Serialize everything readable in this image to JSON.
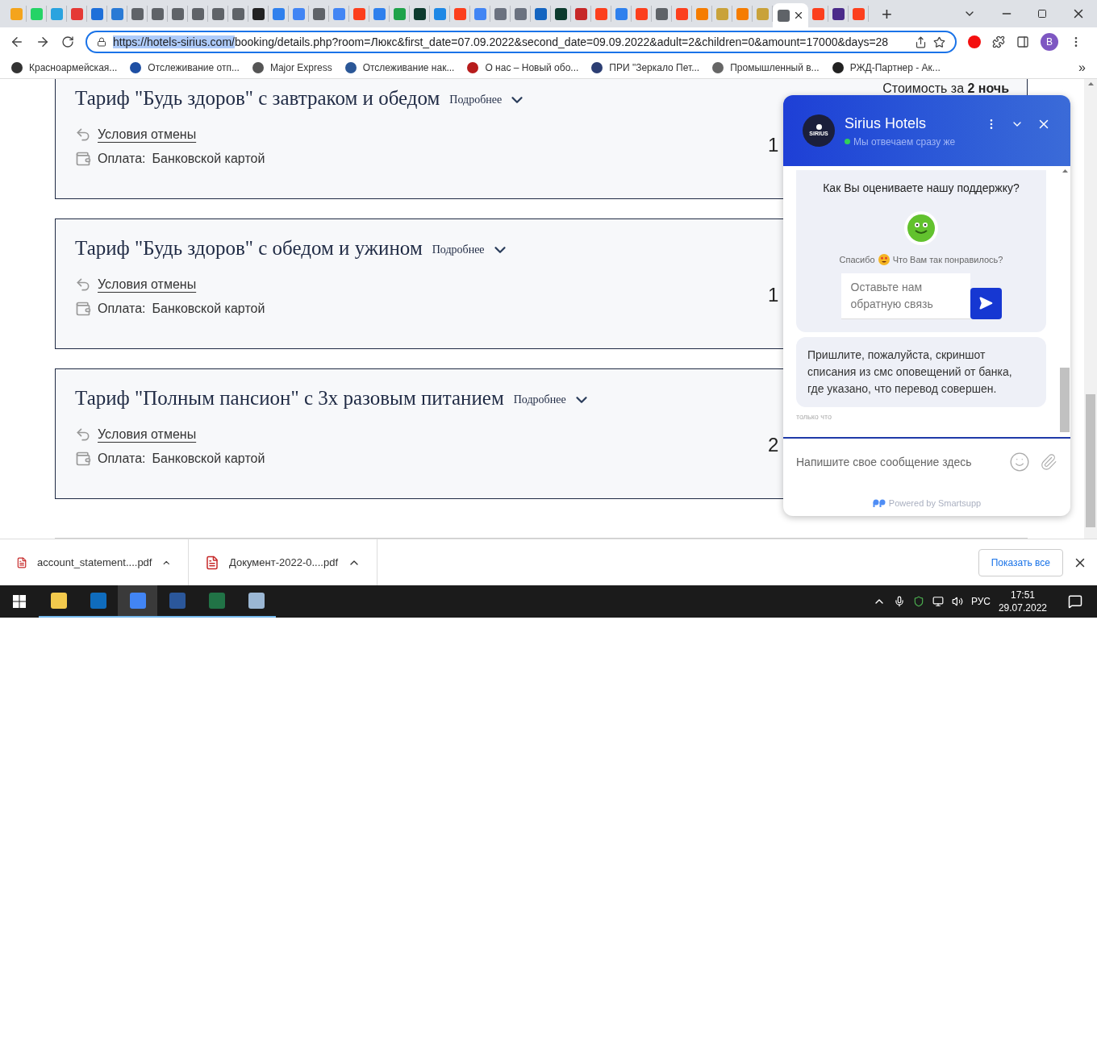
{
  "browser": {
    "tabs": [
      {
        "color": "#f4a41c",
        "selected": false
      },
      {
        "color": "#25d366",
        "selected": false
      },
      {
        "color": "#2aa3df",
        "selected": false
      },
      {
        "color": "#e53935",
        "selected": false
      },
      {
        "color": "#1e6fd9",
        "selected": false
      },
      {
        "color": "#2a7ad5",
        "selected": false
      },
      {
        "color": "#5f6368",
        "selected": false
      },
      {
        "color": "#5f6368",
        "selected": false
      },
      {
        "color": "#5f6368",
        "selected": false
      },
      {
        "color": "#5f6368",
        "selected": false
      },
      {
        "color": "#5f6368",
        "selected": false
      },
      {
        "color": "#5f6368",
        "selected": false
      },
      {
        "color": "#222222",
        "selected": false
      },
      {
        "color": "#2f80ed",
        "selected": false
      },
      {
        "color": "#4285f4",
        "selected": false
      },
      {
        "color": "#5f6368",
        "selected": false
      },
      {
        "color": "#4285f4",
        "selected": false
      },
      {
        "color": "#fc3f1d",
        "selected": false
      },
      {
        "color": "#2f80ed",
        "selected": false
      },
      {
        "color": "#1fa34a",
        "selected": false
      },
      {
        "color": "#0d3b2e",
        "selected": false
      },
      {
        "color": "#1e88e5",
        "selected": false
      },
      {
        "color": "#fc3f1d",
        "selected": false
      },
      {
        "color": "#4285f4",
        "selected": false
      },
      {
        "color": "#6b7280",
        "selected": false
      },
      {
        "color": "#6b7280",
        "selected": false
      },
      {
        "color": "#1565c0",
        "selected": false
      },
      {
        "color": "#0d3b2e",
        "selected": false
      },
      {
        "color": "#c62828",
        "selected": false
      },
      {
        "color": "#fc3f1d",
        "selected": false
      },
      {
        "color": "#2f80ed",
        "selected": false
      },
      {
        "color": "#fc3f1d",
        "selected": false
      },
      {
        "color": "#5f6368",
        "selected": false
      },
      {
        "color": "#fc3f1d",
        "selected": false
      },
      {
        "color": "#f57c00",
        "selected": false
      },
      {
        "color": "#c9a23a",
        "selected": false
      },
      {
        "color": "#f57c00",
        "selected": false
      },
      {
        "color": "#c9a23a",
        "selected": false
      },
      {
        "color": "#5f6368",
        "selected": true
      },
      {
        "color": "#fc3f1d",
        "selected": false
      },
      {
        "color": "#4a2a8a",
        "selected": false
      },
      {
        "color": "#fc3f1d",
        "selected": false
      }
    ],
    "new_tab": "+",
    "address": {
      "highlighted": "https://hotels-sirius.com/",
      "rest": "booking/details.php?room=Люкс&first_date=07.09.2022&second_date=09.09.2022&adult=2&children=0&amount=17000&days=28"
    },
    "profile": "B",
    "bookmarks": [
      {
        "label": "Красноармейская...",
        "color": "#333333"
      },
      {
        "label": "Отслеживание отп...",
        "color": "#1e4fa3"
      },
      {
        "label": "Major Express",
        "color": "#555555"
      },
      {
        "label": "Отслеживание нак...",
        "color": "#2b5797"
      },
      {
        "label": "О нас – Новый обо...",
        "color": "#b71c1c"
      },
      {
        "label": "ПРИ \"Зеркало Пет...",
        "color": "#2c3e73"
      },
      {
        "label": "Промышленный в...",
        "color": "#666666"
      },
      {
        "label": "РЖД-Партнер - Ак...",
        "color": "#222222"
      }
    ],
    "bookmarks_more": "»"
  },
  "page": {
    "cost_label": "Стоимость за **2 ночь**",
    "tariffs": [
      {
        "title": "Тариф \"Будь здоров\" с завтраком и обедом",
        "more": "Подробнее",
        "cancel": "Условия отмены",
        "payment_label": "Оплата:",
        "payment_value": "Банковской картой",
        "price": "1"
      },
      {
        "title": "Тариф \"Будь здоров\" с обедом и ужином",
        "more": "Подробнее",
        "cancel": "Условия отмены",
        "payment_label": "Оплата:",
        "payment_value": "Банковской картой",
        "price": "1"
      },
      {
        "title": "Тариф \"Полным пансион\" с 3х разовым питанием",
        "more": "Подробнее",
        "cancel": "Условия отмены",
        "payment_label": "Оплата:",
        "payment_value": "Банковской картой",
        "price": "2"
      }
    ]
  },
  "chat": {
    "avatar_text": "SIRIUS",
    "title": "Sirius Hotels",
    "status": "Мы отвечаем сразу же",
    "online": true,
    "rating_question": "Как Вы оцениваете нашу поддержку?",
    "thanks": "Спасибо",
    "thanks_question": "Что Вам так понравилось?",
    "feedback_placeholder": "Оставьте нам обратную связь",
    "message": "Пришлите, пожалуйста, скриншот списания из смс оповещений от банка, где указано, что перевод совершен.",
    "message_time": "только что",
    "input_placeholder": "Напишите свое сообщение здесь",
    "powered": "Powered by Smartsupp"
  },
  "downloads": {
    "items": [
      {
        "name": "account_statement....pdf"
      },
      {
        "name": "Документ-2022-0....pdf"
      }
    ],
    "show_all": "Показать все"
  },
  "taskbar": {
    "apps": [
      {
        "color": "#f2c94c",
        "selected": false
      },
      {
        "color": "#0f6cbd",
        "selected": false
      },
      {
        "color": "#4285f4",
        "selected": true
      },
      {
        "color": "#2b579a",
        "selected": false
      },
      {
        "color": "#217346",
        "selected": false
      },
      {
        "color": "#9bb7d4",
        "selected": false
      }
    ],
    "language": "РУС",
    "time": "17:51",
    "date": "29.07.2022"
  }
}
